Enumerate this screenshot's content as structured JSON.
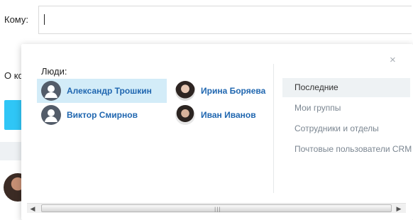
{
  "compose": {
    "to_label": "Кому:",
    "about_label": "О ко"
  },
  "popup": {
    "close_icon": "close-icon",
    "people_title": "Люди:",
    "people": [
      {
        "name": "Александр Трошкин",
        "avatar": "user-silhouette-icon",
        "selected": true
      },
      {
        "name": "Ирина Боряева",
        "avatar": "photo",
        "selected": false
      },
      {
        "name": "Виктор Смирнов",
        "avatar": "user-silhouette-icon",
        "selected": false
      },
      {
        "name": "Иван Иванов",
        "avatar": "photo",
        "selected": false
      }
    ],
    "nav": [
      {
        "label": "Последние",
        "active": true
      },
      {
        "label": "Мои группы",
        "active": false
      },
      {
        "label": "Сотрудники и отделы",
        "active": false
      },
      {
        "label": "Почтовые пользователи CRM",
        "active": false
      }
    ]
  },
  "scrollbar": {
    "left_arrow": "◀",
    "right_arrow": "▶",
    "grip": "|||"
  },
  "colors": {
    "accent_blue": "#2fc6f6",
    "link": "#2067b0",
    "selected_bg": "#d3ecf8"
  }
}
